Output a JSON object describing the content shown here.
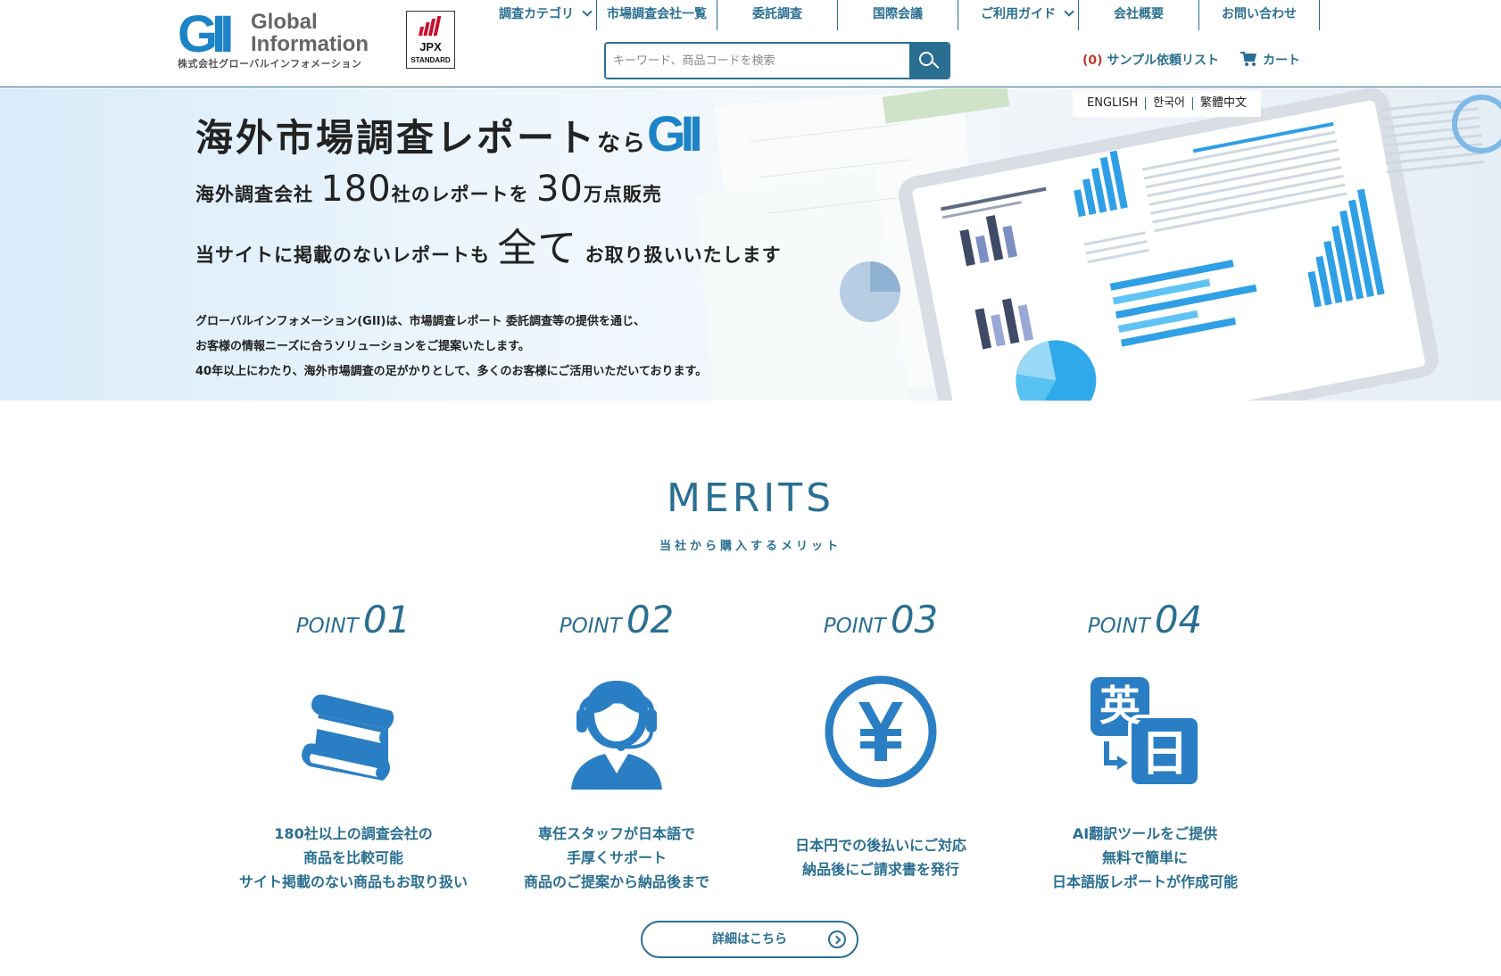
{
  "header": {
    "logo_mark": "GII",
    "logo_line1": "Global",
    "logo_line2": "Information",
    "logo_sub": "株式会社グローバルインフォメーション",
    "jpx_label": "JPX",
    "jpx_sub": "STANDARD",
    "nav": [
      {
        "label": "調査カテゴリ",
        "dropdown": true
      },
      {
        "label": "市場調査会社一覧",
        "dropdown": false
      },
      {
        "label": "委託調査",
        "dropdown": false
      },
      {
        "label": "国際会議",
        "dropdown": false
      },
      {
        "label": "ご利用ガイド",
        "dropdown": true
      },
      {
        "label": "会社概要",
        "dropdown": false
      },
      {
        "label": "お問い合わせ",
        "dropdown": false
      }
    ],
    "search": {
      "placeholder": "キーワード、商品コードを検索",
      "value": ""
    },
    "sample_list": {
      "count": "(0)",
      "label": "サンプル依頼リスト"
    },
    "cart_label": "カート"
  },
  "hero": {
    "languages": [
      "ENGLISH",
      "한국어",
      "繁體中文"
    ],
    "h1_main": "海外市場調査レポート",
    "h1_nara": "なら",
    "h1_brand": "GII",
    "line2": {
      "a": "海外調査会社",
      "num1": "180",
      "b": "社のレポートを",
      "num2": "30",
      "c": "万点販売"
    },
    "line3": {
      "a": "当サイトに掲載のないレポートも",
      "big": "全て",
      "b": "お取り扱いいたします"
    },
    "desc": [
      "グローバルインフォメーション(GII)は、市場調査レポート 委託調査等の提供を通じ、",
      "お客様の情報ニーズに合うソリューションをご提案いたします。",
      "40年以上にわたり、海外市場調査の足がかりとして、多くのお客様にご活用いただいております。"
    ]
  },
  "merits": {
    "title": "MERITS",
    "subtitle": "当社から購入するメリット",
    "points": [
      {
        "word": "POINT",
        "num": "01",
        "icon": "books-icon",
        "lines": [
          "180社以上の調査会社の",
          "商品を比較可能",
          "サイト掲載のない商品もお取り扱い"
        ]
      },
      {
        "word": "POINT",
        "num": "02",
        "icon": "headset-operator-icon",
        "lines": [
          "専任スタッフが日本語で",
          "手厚くサポート",
          "商品のご提案から納品後まで"
        ]
      },
      {
        "word": "POINT",
        "num": "03",
        "icon": "yen-icon",
        "lines": [
          "日本円での後払いにご対応",
          "納品後にご請求書を発行"
        ]
      },
      {
        "word": "POINT",
        "num": "04",
        "icon": "translate-icon",
        "icon_text1": "英",
        "icon_text2": "日",
        "lines": [
          "AI翻訳ツールをご提供",
          "無料で簡単に",
          "日本語版レポートが作成可能"
        ]
      }
    ],
    "detail_button": "詳細はこちら"
  },
  "colors": {
    "brand": "#2a6f91",
    "accent_blue": "#1d83c7",
    "icon_blue": "#2a7fc4"
  }
}
